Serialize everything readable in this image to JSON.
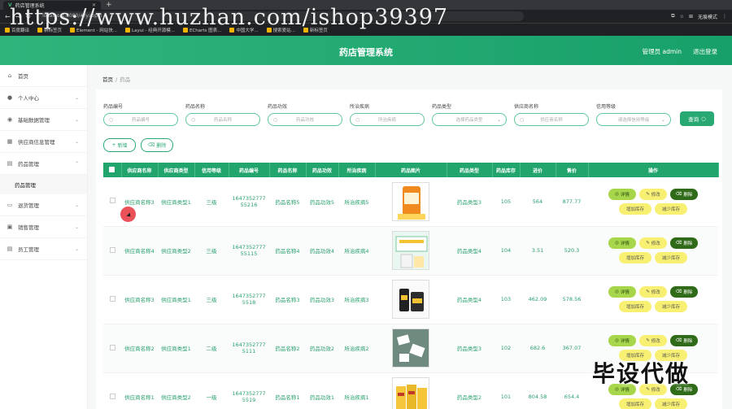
{
  "browser": {
    "tab_title": "药店管理系统",
    "url": "localhost:8080/#/yaopin",
    "bookmarks": [
      "百度翻译",
      "新标签页",
      "Element - 网站快...",
      "Layui - 经典开源模...",
      "ECharts 图表...",
      "中国大学...",
      "搜索爱站...",
      "新标签页"
    ],
    "profile": "无痕模式",
    "watermark": "https://www.huzhan.com/ishop39397"
  },
  "app": {
    "title": "药店管理系统",
    "user_label": "管理员 admin",
    "logout_label": "退出登录"
  },
  "sidebar": {
    "items": [
      {
        "label": "首页",
        "icon": "home-icon",
        "expandable": false
      },
      {
        "label": "个人中心",
        "icon": "user-icon",
        "expandable": true
      },
      {
        "label": "基础数据管理",
        "icon": "location-icon",
        "expandable": true
      },
      {
        "label": "供应商信息管理",
        "icon": "store-icon",
        "expandable": true
      },
      {
        "label": "药品管理",
        "icon": "doc-icon",
        "expandable": true,
        "open": true,
        "children": [
          "药品管理"
        ]
      },
      {
        "label": "退货管理",
        "icon": "list-icon",
        "expandable": true
      },
      {
        "label": "销售管理",
        "icon": "cart-icon",
        "expandable": true
      },
      {
        "label": "员工管理",
        "icon": "doc-icon",
        "expandable": true
      }
    ]
  },
  "breadcrumb": {
    "home": "首页",
    "current": "药品"
  },
  "filters": [
    {
      "label": "药品编号",
      "placeholder": "药品编号",
      "type": "input"
    },
    {
      "label": "药品名称",
      "placeholder": "药品名称",
      "type": "input"
    },
    {
      "label": "药品功效",
      "placeholder": "药品功效",
      "type": "input"
    },
    {
      "label": "所治疾病",
      "placeholder": "所治疾病",
      "type": "input"
    },
    {
      "label": "药品类型",
      "placeholder": "选择药品类型",
      "type": "select"
    },
    {
      "label": "供应商名称",
      "placeholder": "供应商名称",
      "type": "input"
    },
    {
      "label": "信用等级",
      "placeholder": "请选择信用等级",
      "type": "select"
    }
  ],
  "search_label": "查询",
  "add_label": "新增",
  "delete_label": "删除",
  "table": {
    "headers": [
      "供应商名称",
      "供应商类型",
      "信用等级",
      "药品编号",
      "药品名称",
      "药品功效",
      "所治疾病",
      "药品图片",
      "药品类型",
      "药品库存",
      "进价",
      "售价",
      "操作"
    ],
    "rows": [
      {
        "supplier": "供应商名称3",
        "supplier_type": "供应商类型1",
        "credit": "三级",
        "code": "164735277755216",
        "name": "药品名称5",
        "effect": "药品功效5",
        "disease": "所治疾病5",
        "image": "orange-bottle",
        "type": "药品类型3",
        "stock": "105",
        "cost": "564",
        "price": "877.77"
      },
      {
        "supplier": "供应商名称4",
        "supplier_type": "供应商类型2",
        "credit": "三级",
        "code": "164735277755115",
        "name": "药品名称4",
        "effect": "药品功效4",
        "disease": "所治疾病4",
        "image": "supplement-box",
        "type": "药品类型4",
        "stock": "104",
        "cost": "3.51",
        "price": "520.3"
      },
      {
        "supplier": "供应商名称3",
        "supplier_type": "供应商类型1",
        "credit": "三级",
        "code": "16473527775518",
        "name": "药品名称3",
        "effect": "药品功效3",
        "disease": "所治疾病3",
        "image": "dark-bottles",
        "type": "药品类型4",
        "stock": "103",
        "cost": "462.09",
        "price": "578.56"
      },
      {
        "supplier": "供应商名称2",
        "supplier_type": "供应商类型1",
        "credit": "二级",
        "code": "16473527775111",
        "name": "药品名称2",
        "effect": "药品功效2",
        "disease": "所治疾病2",
        "image": "green-packs",
        "type": "药品类型3",
        "stock": "102",
        "cost": "682.6",
        "price": "367.07"
      },
      {
        "supplier": "供应商名称1",
        "supplier_type": "供应商类型2",
        "credit": "一级",
        "code": "16473527775519",
        "name": "药品名称1",
        "effect": "药品功效1",
        "disease": "所治疾病1",
        "image": "yellow-boxes",
        "type": "药品类型2",
        "stock": "101",
        "cost": "804.58",
        "price": "654.4"
      }
    ],
    "ops": {
      "detail": "详情",
      "edit": "修改",
      "del": "删除",
      "add_stock": "增加库存",
      "sub_stock": "减少库存"
    }
  },
  "overlay_text": "毕设代做",
  "colors": {
    "brand": "#21a56d",
    "detail": "#a8d64b",
    "edit": "#f8f072",
    "delete": "#2f6b18"
  }
}
